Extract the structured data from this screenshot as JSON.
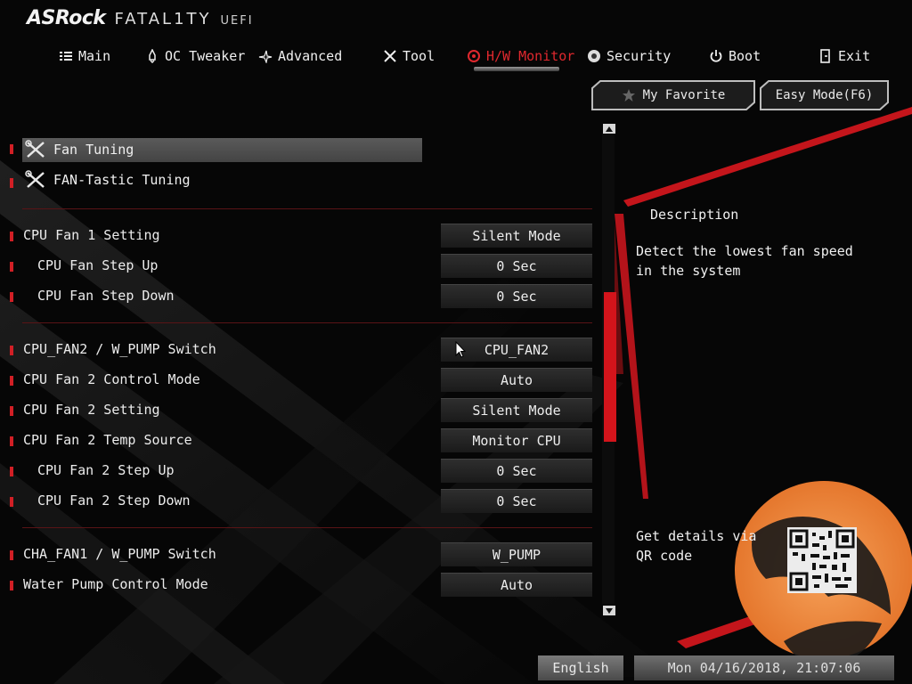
{
  "header": {
    "brand": "ASRock",
    "product": "FATAL1TY",
    "uefi": "UEFI"
  },
  "nav": [
    {
      "label": "Main",
      "icon": "list-icon",
      "active": false
    },
    {
      "label": "OC Tweaker",
      "icon": "rocket-icon",
      "active": false
    },
    {
      "label": "Advanced",
      "icon": "star-icon",
      "active": false
    },
    {
      "label": "Tool",
      "icon": "tools-icon",
      "active": false
    },
    {
      "label": "H/W Monitor",
      "icon": "monitor-gauge-icon",
      "active": true
    },
    {
      "label": "Security",
      "icon": "shield-icon",
      "active": false
    },
    {
      "label": "Boot",
      "icon": "power-icon",
      "active": false
    },
    {
      "label": "Exit",
      "icon": "exit-door-icon",
      "active": false
    }
  ],
  "top_buttons": {
    "favorite": "My Favorite",
    "easy_mode": "Easy Mode(F6)"
  },
  "menu": {
    "fan_tuning": "Fan Tuning",
    "fantastic_tuning": "FAN-Tastic Tuning"
  },
  "settings": [
    {
      "label": "CPU Fan 1 Setting",
      "value": "Silent Mode"
    },
    {
      "label": "CPU Fan Step Up",
      "value": "0 Sec"
    },
    {
      "label": "CPU Fan Step Down",
      "value": "0 Sec"
    },
    {
      "label": "CPU_FAN2 / W_PUMP Switch",
      "value": "CPU_FAN2"
    },
    {
      "label": "CPU Fan 2 Control Mode",
      "value": "Auto"
    },
    {
      "label": "CPU Fan 2 Setting",
      "value": "Silent Mode"
    },
    {
      "label": "CPU Fan 2 Temp Source",
      "value": "Monitor CPU"
    },
    {
      "label": "CPU Fan 2 Step Up",
      "value": "0 Sec"
    },
    {
      "label": "CPU Fan 2 Step Down",
      "value": "0 Sec"
    },
    {
      "label": "CHA_FAN1 / W_PUMP Switch",
      "value": "W_PUMP"
    },
    {
      "label": "Water Pump Control Mode",
      "value": "Auto"
    }
  ],
  "description": {
    "title": "Description",
    "text": "Detect the lowest fan speed in the system",
    "qr_text": "Get details via QR code"
  },
  "footer": {
    "language": "English",
    "datetime": "Mon 04/16/2018, 21:07:06"
  },
  "colors": {
    "accent": "#d3141b",
    "selected_row": "#4d4d4d",
    "background": "#060606"
  }
}
